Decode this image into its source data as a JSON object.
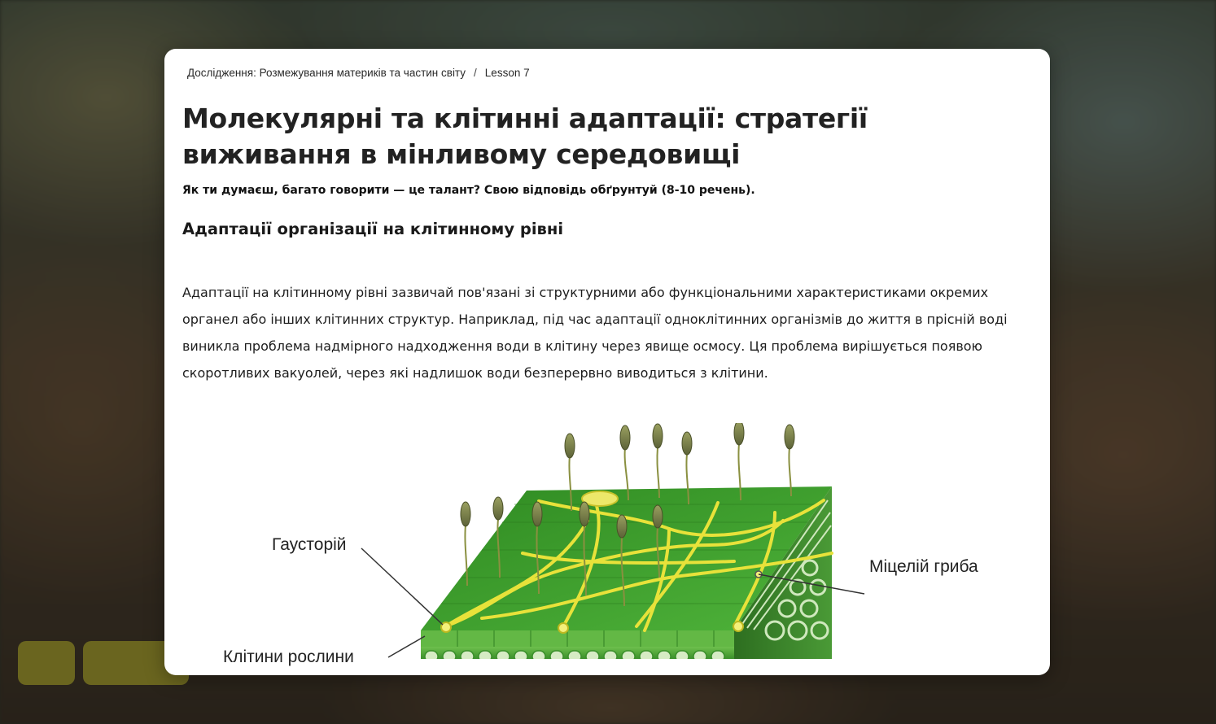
{
  "breadcrumb": {
    "course": "Дослідження: Розмежування материків та частин світу",
    "separator": "/",
    "lesson": "Lesson 7"
  },
  "lesson": {
    "title": "Молекулярні та клітинні адаптації: стратегії виживання в мінливому середовищі",
    "prompt": "Як ти думаєш, багато говорити — це талант? Свою відповідь обґрунтуй (8-10 речень).",
    "section_heading": "Адаптації організації на клітинному рівні",
    "paragraph": "Адаптації на клітинному рівні зазвичай пов'язані зі структурними або функціональними характеристиками окремих органел або інших клітинних структур. Наприклад, під час адаптації одноклітинних організмів до життя в прісній воді виникла проблема надмірного надходження води в клітину через явище осмосу. Ця проблема вирішується появою скоротливих вакуолей, через які надлишок води безперервно виводиться з клітини."
  },
  "figure": {
    "label_haustorium": "Гаусторій",
    "label_mycelium": "Міцелій гриба",
    "label_cells": "Клітини рослини"
  },
  "colors": {
    "card_bg": "#ffffff",
    "leaf_green": "#3f9a2c",
    "mycelium_yellow": "#e8e23a"
  }
}
